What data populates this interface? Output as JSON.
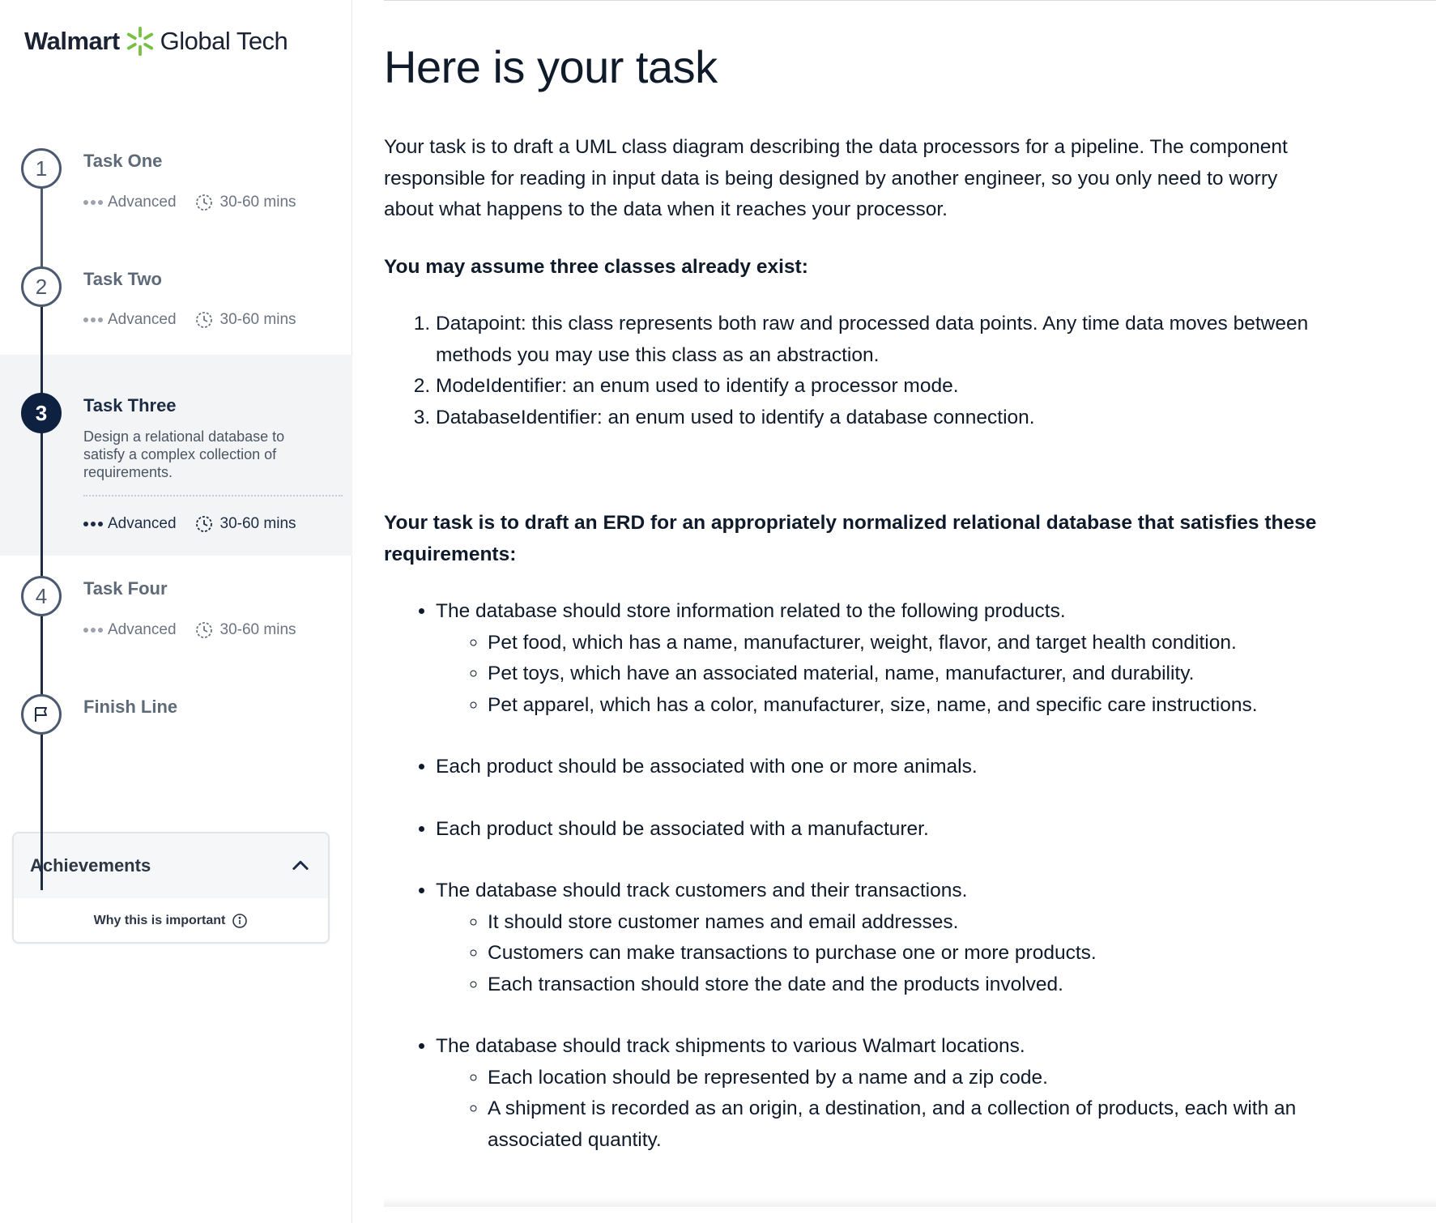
{
  "brand": {
    "name": "Walmart",
    "suffix": "Global Tech",
    "spark_color": "#76c043"
  },
  "steps": [
    {
      "number": "1",
      "title": "Task One",
      "level": "Advanced",
      "duration": "30-60 mins"
    },
    {
      "number": "2",
      "title": "Task Two",
      "level": "Advanced",
      "duration": "30-60 mins"
    },
    {
      "number": "3",
      "title": "Task Three",
      "description": "Design a relational database to satisfy a complex collection of requirements.",
      "level": "Advanced",
      "duration": "30-60 mins",
      "active": true
    },
    {
      "number": "4",
      "title": "Task Four",
      "level": "Advanced",
      "duration": "30-60 mins"
    },
    {
      "title": "Finish Line",
      "icon": "flag-icon"
    }
  ],
  "achievements": {
    "title": "Achievements",
    "why_label": "Why this is important"
  },
  "main": {
    "title": "Here is your task",
    "intro": "Your task is to draft a UML class diagram describing the data processors for a pipeline. The component responsible for reading in input data is being designed by another engineer, so you only need to worry about what happens to the data when it reaches your processor.",
    "assume_heading": "You may assume three classes already exist:",
    "classes": [
      "Datapoint: this class represents both raw and processed data points. Any time data moves between methods you may use this class as an abstraction.",
      "ModeIdentifier: an enum used to identify a processor mode.",
      "DatabaseIdentifier: an enum used to identify a database connection."
    ],
    "erd_heading": "Your task is to draft an ERD for an appropriately normalized relational database that satisfies these requirements:",
    "requirements": [
      {
        "text": "The database should store information related to the following products.",
        "sub": [
          "Pet food, which has a name, manufacturer, weight, flavor, and target health condition.",
          "Pet toys, which have an associated material, name, manufacturer, and durability.",
          "Pet apparel, which has a color, manufacturer, size, name, and specific care instructions."
        ]
      },
      {
        "text": "Each product should be associated with one or more animals."
      },
      {
        "text": "Each product should be associated with a manufacturer."
      },
      {
        "text": "The database should track customers and their transactions.",
        "sub": [
          "It should store customer names and email addresses.",
          "Customers can make transactions to purchase one or more products.",
          "Each transaction should store the date and the products involved."
        ]
      },
      {
        "text": "The database should track shipments to various Walmart locations.",
        "sub": [
          "Each location should be represented by a name and a zip code.",
          "A shipment is recorded as an origin, a destination, and a collection of products, each with an associated quantity."
        ]
      }
    ]
  }
}
